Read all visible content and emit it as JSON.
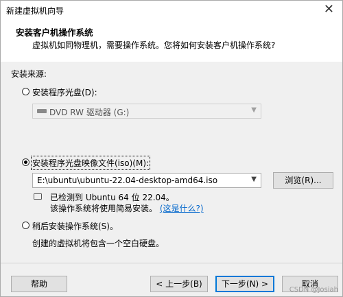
{
  "window": {
    "title": "新建虚拟机向导",
    "close_glyph": "✕"
  },
  "header": {
    "title": "安装客户机操作系统",
    "subtitle": "虚拟机如同物理机，需要操作系统。您将如何安装客户机操作系统?"
  },
  "install_source": {
    "label": "安装来源:",
    "options": [
      {
        "label": "安装程序光盘(D):",
        "selected": false
      },
      {
        "label": "安装程序光盘映像文件(iso)(M):",
        "selected": true
      },
      {
        "label": "稍后安装操作系统(S)。",
        "selected": false
      }
    ],
    "disc_drive": {
      "value": "DVD RW 驱动器 (G:)",
      "icon": "disc-drive-icon",
      "enabled": false
    },
    "iso_path": {
      "value": "E:\\ubuntu\\ubuntu-22.04-desktop-amd64.iso"
    },
    "browse_label": "浏览(R)...",
    "detect": {
      "icon": "info-speech-icon",
      "line1": "已检测到 Ubuntu 64 位 22.04。",
      "line2": "该操作系统将使用简易安装。",
      "link": "(这是什么?)"
    },
    "later_desc": "创建的虚拟机将包含一个空白硬盘。"
  },
  "footer": {
    "help": "帮助",
    "back": "< 上一步(B)",
    "next": "下一步(N) >",
    "cancel": "取消"
  },
  "watermark": "CSDN @Josiah"
}
